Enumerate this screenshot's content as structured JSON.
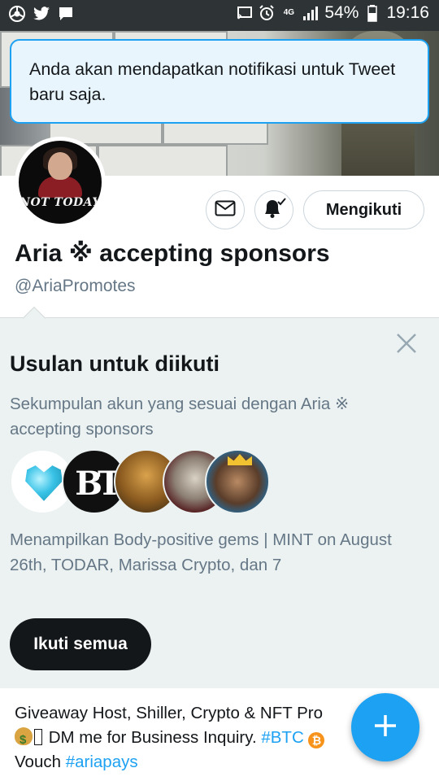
{
  "status_bar": {
    "left_icons": [
      "chrome-icon",
      "twitter-icon",
      "message-icon"
    ],
    "right_icons": [
      "cast-icon",
      "alarm-icon",
      "network-4g-icon",
      "signal-icon"
    ],
    "network": "4G",
    "battery": "54%",
    "time": "19:16"
  },
  "toast": {
    "message": "Anda akan mendapatkan notifikasi untuk Tweet baru saja."
  },
  "profile": {
    "avatar_text": "NOT TODAY",
    "name": "Aria ※ accepting sponsors",
    "handle": "@AriaPromotes",
    "follow_button": "Mengikuti"
  },
  "suggestions": {
    "title": "Usulan untuk diikuti",
    "subtitle": "Sekumpulan akun yang sesuai dengan Aria ※ accepting sponsors",
    "avatar_logo_text": "BT",
    "description": "Menampilkan Body-positive gems | MINT on August 26th, TODAR, Marissa Crypto, dan 7",
    "follow_all_button": "Ikuti semua"
  },
  "bio": {
    "line1": "Giveaway Host, Shiller, Crypto & NFT Pro",
    "line2_text": " DM me for Business Inquiry. ",
    "hashtag_btc": "#BTC",
    "line3_text": "Vouch ",
    "hashtag_ariapays": "#ariapays"
  },
  "colors": {
    "accent": "#1da1f2",
    "status_bar": "#2e3436",
    "panel_bg": "#ecf2f1",
    "secondary_text": "#657786"
  }
}
